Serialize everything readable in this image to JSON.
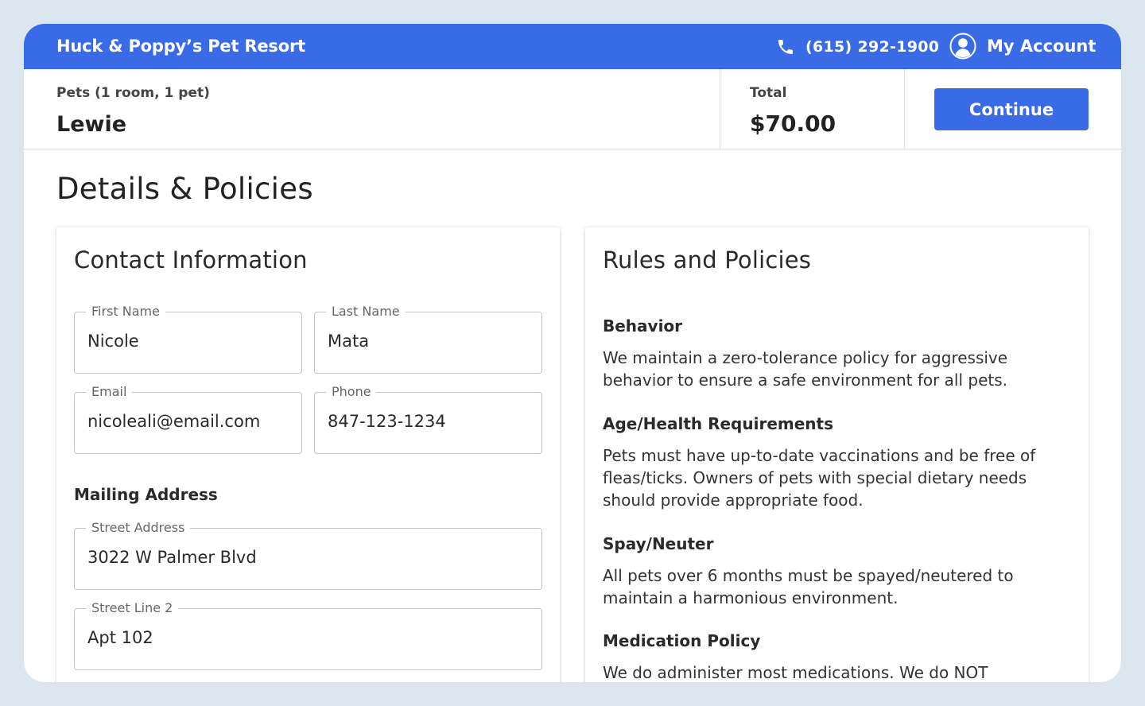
{
  "header": {
    "brand": "Huck & Poppy’s Pet Resort",
    "phone": "(615) 292-1900",
    "account": "My Account",
    "accent": "#3a6be6"
  },
  "summary": {
    "pets_label": "Pets (1 room, 1 pet)",
    "pets_name": "Lewie",
    "total_label": "Total",
    "total_value": "$70.00",
    "continue_label": "Continue"
  },
  "page_title": "Details & Policies",
  "contact": {
    "title": "Contact Information",
    "first_name": {
      "label": "First Name",
      "value": "Nicole"
    },
    "last_name": {
      "label": "Last Name",
      "value": "Mata"
    },
    "email": {
      "label": "Email",
      "value": "nicoleali@email.com"
    },
    "phone": {
      "label": "Phone",
      "value": "847-123-1234"
    },
    "mailing_title": "Mailing Address",
    "street": {
      "label": "Street Address",
      "value": "3022 W Palmer Blvd"
    },
    "street2": {
      "label": "Street Line 2",
      "value": "Apt 102"
    }
  },
  "policies": {
    "title": "Rules and Policies",
    "items": [
      {
        "heading": "Behavior",
        "body": "We maintain a zero-tolerance policy for aggressive behavior to ensure a safe environment for all pets."
      },
      {
        "heading": "Age/Health Requirements",
        "body": "Pets must have up-to-date vaccinations and be free of fleas/ticks. Owners of pets with special dietary needs should provide appropriate food."
      },
      {
        "heading": "Spay/Neuter",
        "body": "All pets over 6 months must be spayed/neutered to maintain a harmonious environment."
      },
      {
        "heading": "Medication Policy",
        "body": "We do administer most medications. We do NOT"
      }
    ]
  },
  "icons": {
    "phone": "phone-icon",
    "account": "user-circle-icon"
  }
}
